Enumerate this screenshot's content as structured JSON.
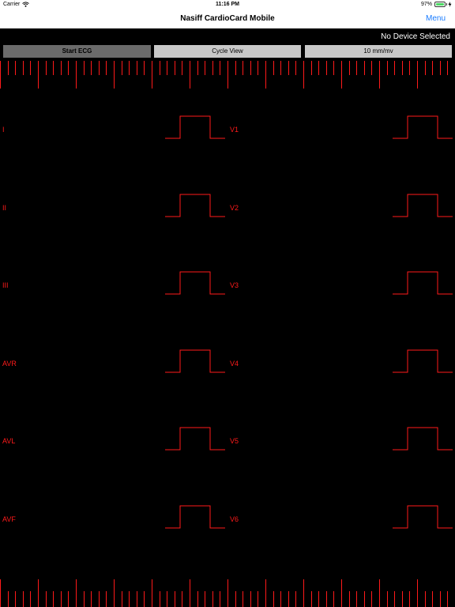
{
  "status_bar": {
    "carrier": "Carrier",
    "wifi_icon": "wifi-icon",
    "time": "11:16 PM",
    "battery_percent": "97%",
    "battery_level": 0.97,
    "charging_icon": "bolt-icon"
  },
  "nav": {
    "title": "Nasiff CardioCard Mobile",
    "menu_label": "Menu"
  },
  "device_status": "No Device Selected",
  "toolbar": {
    "start_label": "Start ECG",
    "cycle_label": "Cycle View",
    "scale_label": "10 mm/mv"
  },
  "leads": {
    "left": [
      "I",
      "II",
      "III",
      "AVR",
      "AVL",
      "AVF"
    ],
    "right": [
      "V1",
      "V2",
      "V3",
      "V4",
      "V5",
      "V6"
    ]
  },
  "colors": {
    "trace": "#ff1a1a",
    "accent": "#1a7cff",
    "background": "#000000"
  }
}
